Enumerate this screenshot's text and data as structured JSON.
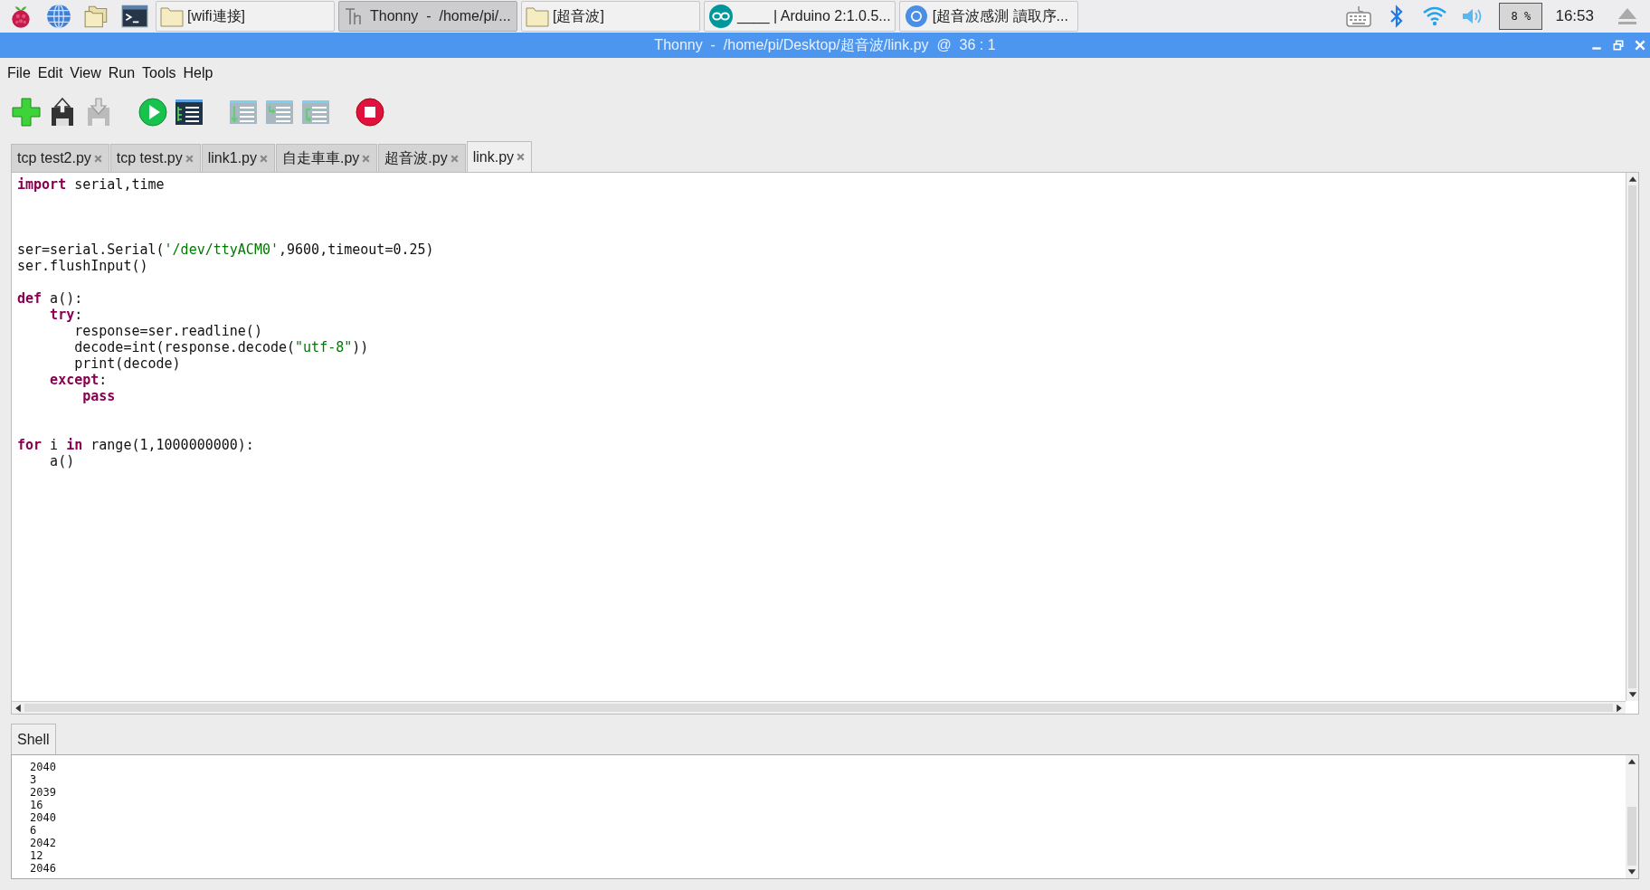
{
  "taskbar": {
    "launchers": [
      {
        "kind": "raspberry"
      },
      {
        "kind": "globe"
      },
      {
        "kind": "folders"
      },
      {
        "kind": "terminal"
      }
    ],
    "windows": [
      {
        "kind": "folder",
        "label": "[wifi連接]",
        "selected": false
      },
      {
        "kind": "thonny",
        "label": "Thonny  -  /home/pi/...",
        "selected": true
      },
      {
        "kind": "folder",
        "label": "[超音波]",
        "selected": false
      },
      {
        "kind": "arduino",
        "label": "____ | Arduino 2:1.0.5...",
        "selected": false
      },
      {
        "kind": "chromium",
        "label": "[超音波感測 讀取序...",
        "selected": false
      }
    ],
    "cpu": "8 %",
    "clock": "16:53"
  },
  "window": {
    "title": "Thonny  -  /home/pi/Desktop/超音波/link.py  @  36 : 1"
  },
  "menu": [
    "File",
    "Edit",
    "View",
    "Run",
    "Tools",
    "Help"
  ],
  "toolbar": [
    {
      "kind": "new"
    },
    {
      "kind": "load"
    },
    {
      "kind": "save"
    },
    {
      "kind": "gap"
    },
    {
      "kind": "run"
    },
    {
      "kind": "debug"
    },
    {
      "kind": "gap"
    },
    {
      "kind": "step-over"
    },
    {
      "kind": "step-into"
    },
    {
      "kind": "step-out"
    },
    {
      "kind": "gap"
    },
    {
      "kind": "stop"
    }
  ],
  "tabs": [
    {
      "label": "tcp test2.py",
      "selected": false
    },
    {
      "label": "tcp test.py",
      "selected": false
    },
    {
      "label": "link1.py",
      "selected": false
    },
    {
      "label": "自走車車.py",
      "selected": false
    },
    {
      "label": "超音波.py",
      "selected": false
    },
    {
      "label": "link.py",
      "selected": true
    }
  ],
  "code": [
    {
      "kind": "code",
      "tokens": [
        {
          "kind": "kw",
          "text": "import"
        },
        {
          "kind": "plain",
          "text": " serial,time"
        }
      ]
    },
    {
      "kind": "blank"
    },
    {
      "kind": "blank"
    },
    {
      "kind": "blank"
    },
    {
      "kind": "code",
      "tokens": [
        {
          "kind": "plain",
          "text": "ser=serial.Serial("
        },
        {
          "kind": "str",
          "text": "'/dev/ttyACM0'"
        },
        {
          "kind": "plain",
          "text": ",9600,timeout=0.25)"
        }
      ]
    },
    {
      "kind": "code",
      "tokens": [
        {
          "kind": "plain",
          "text": "ser.flushInput()"
        }
      ]
    },
    {
      "kind": "blank"
    },
    {
      "kind": "code",
      "tokens": [
        {
          "kind": "kw",
          "text": "def"
        },
        {
          "kind": "plain",
          "text": " a():"
        }
      ]
    },
    {
      "kind": "code",
      "tokens": [
        {
          "kind": "kw",
          "text": "    try"
        },
        {
          "kind": "plain",
          "text": ":"
        }
      ]
    },
    {
      "kind": "code",
      "tokens": [
        {
          "kind": "plain",
          "text": "       response=ser.readline()"
        }
      ]
    },
    {
      "kind": "code",
      "tokens": [
        {
          "kind": "plain",
          "text": "       decode=int(response.decode("
        },
        {
          "kind": "str",
          "text": "\"utf-8\""
        },
        {
          "kind": "plain",
          "text": "))"
        }
      ]
    },
    {
      "kind": "code",
      "tokens": [
        {
          "kind": "plain",
          "text": "       print(decode)"
        }
      ]
    },
    {
      "kind": "code",
      "tokens": [
        {
          "kind": "kw",
          "text": "    except"
        },
        {
          "kind": "plain",
          "text": ":"
        }
      ]
    },
    {
      "kind": "code",
      "tokens": [
        {
          "kind": "kw",
          "text": "        pass"
        }
      ]
    },
    {
      "kind": "blank"
    },
    {
      "kind": "blank"
    },
    {
      "kind": "code",
      "tokens": [
        {
          "kind": "kw",
          "text": "for"
        },
        {
          "kind": "plain",
          "text": " i "
        },
        {
          "kind": "kw",
          "text": "in"
        },
        {
          "kind": "plain",
          "text": " range(1,1000000000):"
        }
      ]
    },
    {
      "kind": "code",
      "tokens": [
        {
          "kind": "plain",
          "text": "    a()"
        }
      ]
    }
  ],
  "shell": {
    "tab": "Shell",
    "lines": [
      "2040",
      "3",
      "2039",
      "16",
      "2040",
      "6",
      "2042",
      "12",
      "2046"
    ]
  }
}
